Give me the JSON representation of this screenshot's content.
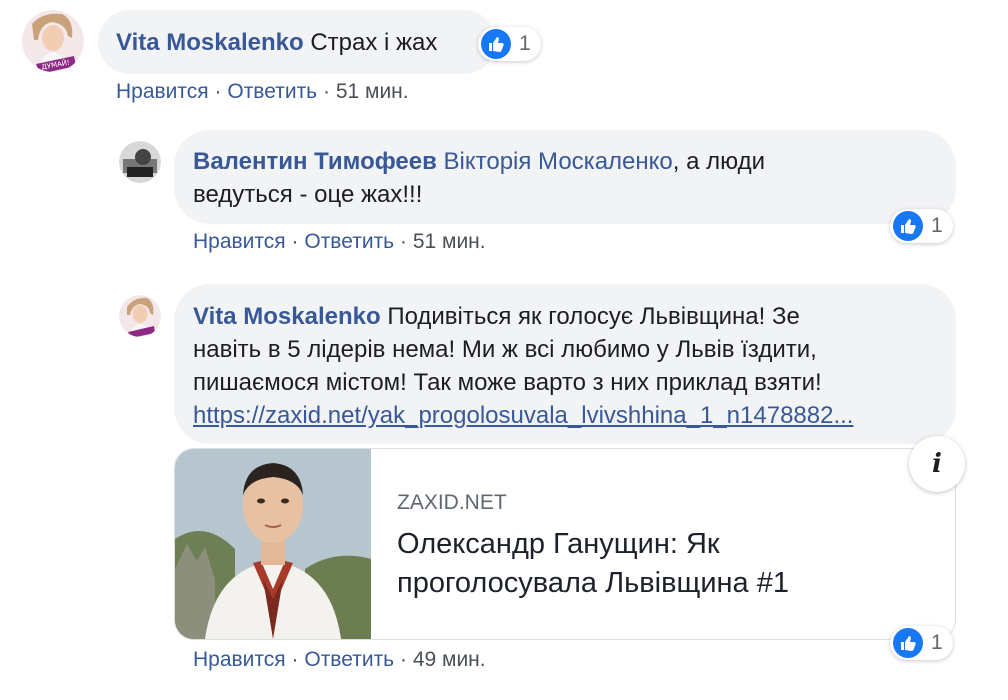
{
  "comments": [
    {
      "author": "Vita Moskalenko",
      "text": "Страх і жах",
      "reaction_count": "1",
      "like": "Нравится",
      "reply": "Ответить",
      "time": "51 мин.",
      "avatar_badge": "ДУМАЙ!"
    },
    {
      "author": "Валентин Тимофеев",
      "mention": "Вікторія Москаленко",
      "text_line1": ", а люди",
      "text_line2": "ведуться - оце жах!!!",
      "reaction_count": "1",
      "like": "Нравится",
      "reply": "Ответить",
      "time": "51 мин."
    },
    {
      "author": "Vita Moskalenko",
      "text_line1": "Подивіться як голосує Львівщина! Зе",
      "text_line2": "навіть в 5 лідерів нема! Ми ж всі любимо у Львів їздити,",
      "text_line3": "пишаємося містом! Так може варто з них приклад взяти!",
      "link": "https://zaxid.net/yak_progolosuvala_lvivshhina_1_n1478882...",
      "reaction_count": "1",
      "like": "Нравится",
      "reply": "Ответить",
      "time": "49 мин.",
      "preview": {
        "domain": "ZAXID.NET",
        "title_line1": "Олександр Ганущин: Як",
        "title_line2": "проголосувала Львівщина #1"
      }
    }
  ],
  "separator": "·",
  "info_glyph": "i",
  "colors": {
    "link": "#385898",
    "bubble": "#f2f3f5",
    "like": "#1877f2"
  },
  "icons": [
    "like-icon",
    "info-icon"
  ]
}
